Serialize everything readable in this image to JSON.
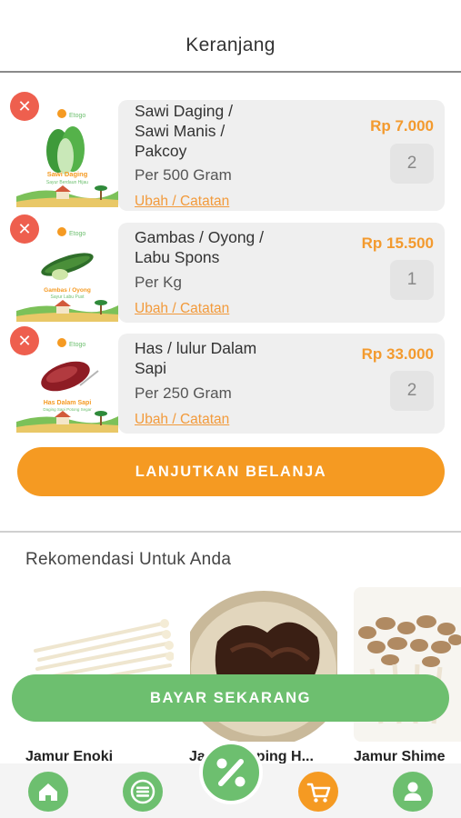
{
  "header": {
    "title": "Keranjang"
  },
  "cart": {
    "items": [
      {
        "name": "Sawi Daging / Sawi Manis / Pakcoy",
        "unit": "Per 500 Gram",
        "price": "Rp 7.000",
        "quantity": "2",
        "edit_label": "Ubah / Catatan",
        "image": {
          "brand": "Etogo",
          "title": "Sawi Daging",
          "subtitle": "Sayur Berdaun Hijau"
        }
      },
      {
        "name": "Gambas / Oyong / Labu Spons",
        "unit": "Per Kg",
        "price": "Rp 15.500",
        "quantity": "1",
        "edit_label": "Ubah / Catatan",
        "image": {
          "brand": "Etogo",
          "title": "Gambas / Oyong",
          "subtitle": "Sayur Labu Pust"
        }
      },
      {
        "name": "Has / lulur Dalam Sapi",
        "unit": "Per 250 Gram",
        "price": "Rp 33.000",
        "quantity": "2",
        "edit_label": "Ubah / Catatan",
        "image": {
          "brand": "Etogo",
          "title": "Has Dalam Sapi",
          "subtitle": "Daging Sapi Potong Segar"
        }
      }
    ],
    "remove_icon": "close-icon",
    "continue_label": "LANJUTKAN BELANJA"
  },
  "recommendations": {
    "title": "Rekomendasi Untuk Anda",
    "products": [
      {
        "name": "Jamur Enoki"
      },
      {
        "name": "Jamur Kuping H..."
      },
      {
        "name": "Jamur Shime"
      }
    ]
  },
  "pay_label": "BAYAR SEKARANG",
  "bottom_nav": {
    "items": [
      {
        "icon": "home-icon"
      },
      {
        "icon": "menu-icon"
      },
      {
        "icon": "percent-icon"
      },
      {
        "icon": "cart-icon"
      },
      {
        "icon": "user-icon"
      }
    ]
  },
  "colors": {
    "accent_orange": "#f59a22",
    "accent_green": "#6dbf6f",
    "remove_red": "#ee5f4e"
  }
}
